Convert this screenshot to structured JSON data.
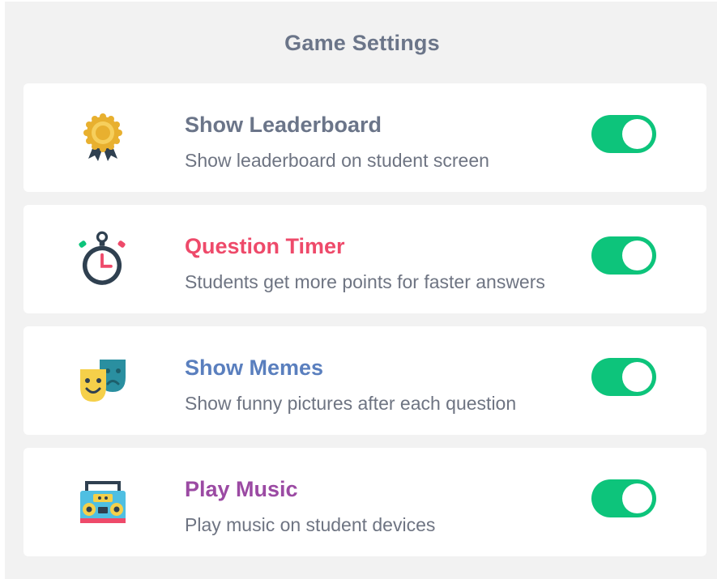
{
  "panel": {
    "title": "Game Settings"
  },
  "colors": {
    "toggle_on": "#0dc47b",
    "leaderboard_title": "#6b7589",
    "timer_title": "#ee4a6a",
    "memes_title": "#5a7fbe",
    "music_title": "#9b4aa3"
  },
  "settings": [
    {
      "title": "Show Leaderboard",
      "description": "Show leaderboard on student screen",
      "icon": "award-medal-icon",
      "enabled": true
    },
    {
      "title": "Question Timer",
      "description": "Students get more points for faster answers",
      "icon": "stopwatch-icon",
      "enabled": true
    },
    {
      "title": "Show Memes",
      "description": "Show funny pictures after each question",
      "icon": "theater-masks-icon",
      "enabled": true
    },
    {
      "title": "Play Music",
      "description": "Play music on student devices",
      "icon": "boombox-icon",
      "enabled": true
    }
  ]
}
